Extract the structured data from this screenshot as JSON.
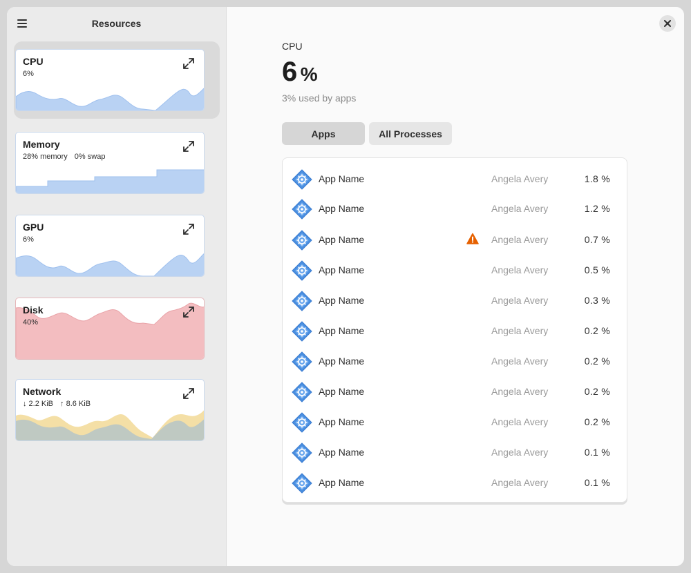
{
  "sidebar": {
    "title": "Resources",
    "cards": [
      {
        "title": "CPU",
        "sub": "6%"
      },
      {
        "title": "Memory",
        "sub1": "28% memory",
        "sub2": "0% swap"
      },
      {
        "title": "GPU",
        "sub": "6%"
      },
      {
        "title": "Disk",
        "sub": "40%"
      },
      {
        "title": "Network",
        "sub1": "↓ 2.2 KiB",
        "sub2": "↑ 8.6 KiB"
      }
    ]
  },
  "main": {
    "resource_label": "CPU",
    "value": "6",
    "unit": "%",
    "note": "3% used by apps",
    "tabs": [
      "Apps",
      "All Processes"
    ],
    "rows": [
      {
        "name": "App Name",
        "user": "Angela Avery",
        "pct": "1.8 %",
        "warning": false
      },
      {
        "name": "App Name",
        "user": "Angela Avery",
        "pct": "1.2 %",
        "warning": false
      },
      {
        "name": "App Name",
        "user": "Angela Avery",
        "pct": "0.7 %",
        "warning": true
      },
      {
        "name": "App Name",
        "user": "Angela Avery",
        "pct": "0.5 %",
        "warning": false
      },
      {
        "name": "App Name",
        "user": "Angela Avery",
        "pct": "0.3 %",
        "warning": false
      },
      {
        "name": "App Name",
        "user": "Angela Avery",
        "pct": "0.2 %",
        "warning": false
      },
      {
        "name": "App Name",
        "user": "Angela Avery",
        "pct": "0.2 %",
        "warning": false
      },
      {
        "name": "App Name",
        "user": "Angela Avery",
        "pct": "0.2 %",
        "warning": false
      },
      {
        "name": "App Name",
        "user": "Angela Avery",
        "pct": "0.2 %",
        "warning": false
      },
      {
        "name": "App Name",
        "user": "Angela Avery",
        "pct": "0.1 %",
        "warning": false
      },
      {
        "name": "App Name",
        "user": "Angela Avery",
        "pct": "0.1 %",
        "warning": false
      }
    ]
  },
  "icons": {
    "menu": "hamburger-menu-icon",
    "expand": "expand-icon",
    "close": "close-icon",
    "app": "app-gear-icon",
    "warning": "warning-icon"
  },
  "colors": {
    "graph_blue": "#b9d2f3",
    "graph_blue_line": "#9fc0ee",
    "graph_red": "#f3bdc0",
    "graph_red_line": "#e9a3a8",
    "graph_yellow": "#f4dfa6",
    "warning": "#e66100",
    "app_icon": "#4a8fe0"
  }
}
